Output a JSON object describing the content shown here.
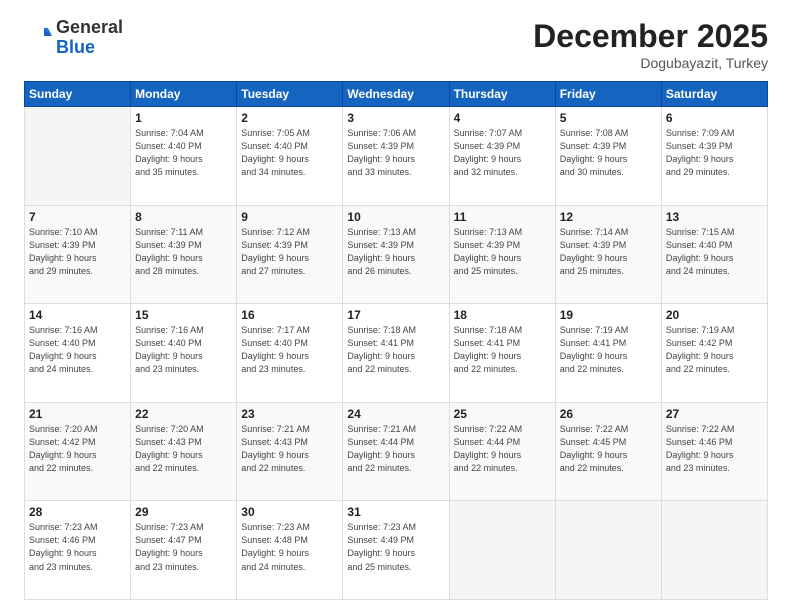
{
  "header": {
    "logo_general": "General",
    "logo_blue": "Blue",
    "month_title": "December 2025",
    "location": "Dogubayazit, Turkey"
  },
  "days_of_week": [
    "Sunday",
    "Monday",
    "Tuesday",
    "Wednesday",
    "Thursday",
    "Friday",
    "Saturday"
  ],
  "weeks": [
    [
      {
        "day": "",
        "info": ""
      },
      {
        "day": "1",
        "info": "Sunrise: 7:04 AM\nSunset: 4:40 PM\nDaylight: 9 hours\nand 35 minutes."
      },
      {
        "day": "2",
        "info": "Sunrise: 7:05 AM\nSunset: 4:40 PM\nDaylight: 9 hours\nand 34 minutes."
      },
      {
        "day": "3",
        "info": "Sunrise: 7:06 AM\nSunset: 4:39 PM\nDaylight: 9 hours\nand 33 minutes."
      },
      {
        "day": "4",
        "info": "Sunrise: 7:07 AM\nSunset: 4:39 PM\nDaylight: 9 hours\nand 32 minutes."
      },
      {
        "day": "5",
        "info": "Sunrise: 7:08 AM\nSunset: 4:39 PM\nDaylight: 9 hours\nand 30 minutes."
      },
      {
        "day": "6",
        "info": "Sunrise: 7:09 AM\nSunset: 4:39 PM\nDaylight: 9 hours\nand 29 minutes."
      }
    ],
    [
      {
        "day": "7",
        "info": "Sunrise: 7:10 AM\nSunset: 4:39 PM\nDaylight: 9 hours\nand 29 minutes."
      },
      {
        "day": "8",
        "info": "Sunrise: 7:11 AM\nSunset: 4:39 PM\nDaylight: 9 hours\nand 28 minutes."
      },
      {
        "day": "9",
        "info": "Sunrise: 7:12 AM\nSunset: 4:39 PM\nDaylight: 9 hours\nand 27 minutes."
      },
      {
        "day": "10",
        "info": "Sunrise: 7:13 AM\nSunset: 4:39 PM\nDaylight: 9 hours\nand 26 minutes."
      },
      {
        "day": "11",
        "info": "Sunrise: 7:13 AM\nSunset: 4:39 PM\nDaylight: 9 hours\nand 25 minutes."
      },
      {
        "day": "12",
        "info": "Sunrise: 7:14 AM\nSunset: 4:39 PM\nDaylight: 9 hours\nand 25 minutes."
      },
      {
        "day": "13",
        "info": "Sunrise: 7:15 AM\nSunset: 4:40 PM\nDaylight: 9 hours\nand 24 minutes."
      }
    ],
    [
      {
        "day": "14",
        "info": "Sunrise: 7:16 AM\nSunset: 4:40 PM\nDaylight: 9 hours\nand 24 minutes."
      },
      {
        "day": "15",
        "info": "Sunrise: 7:16 AM\nSunset: 4:40 PM\nDaylight: 9 hours\nand 23 minutes."
      },
      {
        "day": "16",
        "info": "Sunrise: 7:17 AM\nSunset: 4:40 PM\nDaylight: 9 hours\nand 23 minutes."
      },
      {
        "day": "17",
        "info": "Sunrise: 7:18 AM\nSunset: 4:41 PM\nDaylight: 9 hours\nand 22 minutes."
      },
      {
        "day": "18",
        "info": "Sunrise: 7:18 AM\nSunset: 4:41 PM\nDaylight: 9 hours\nand 22 minutes."
      },
      {
        "day": "19",
        "info": "Sunrise: 7:19 AM\nSunset: 4:41 PM\nDaylight: 9 hours\nand 22 minutes."
      },
      {
        "day": "20",
        "info": "Sunrise: 7:19 AM\nSunset: 4:42 PM\nDaylight: 9 hours\nand 22 minutes."
      }
    ],
    [
      {
        "day": "21",
        "info": "Sunrise: 7:20 AM\nSunset: 4:42 PM\nDaylight: 9 hours\nand 22 minutes."
      },
      {
        "day": "22",
        "info": "Sunrise: 7:20 AM\nSunset: 4:43 PM\nDaylight: 9 hours\nand 22 minutes."
      },
      {
        "day": "23",
        "info": "Sunrise: 7:21 AM\nSunset: 4:43 PM\nDaylight: 9 hours\nand 22 minutes."
      },
      {
        "day": "24",
        "info": "Sunrise: 7:21 AM\nSunset: 4:44 PM\nDaylight: 9 hours\nand 22 minutes."
      },
      {
        "day": "25",
        "info": "Sunrise: 7:22 AM\nSunset: 4:44 PM\nDaylight: 9 hours\nand 22 minutes."
      },
      {
        "day": "26",
        "info": "Sunrise: 7:22 AM\nSunset: 4:45 PM\nDaylight: 9 hours\nand 22 minutes."
      },
      {
        "day": "27",
        "info": "Sunrise: 7:22 AM\nSunset: 4:46 PM\nDaylight: 9 hours\nand 23 minutes."
      }
    ],
    [
      {
        "day": "28",
        "info": "Sunrise: 7:23 AM\nSunset: 4:46 PM\nDaylight: 9 hours\nand 23 minutes."
      },
      {
        "day": "29",
        "info": "Sunrise: 7:23 AM\nSunset: 4:47 PM\nDaylight: 9 hours\nand 23 minutes."
      },
      {
        "day": "30",
        "info": "Sunrise: 7:23 AM\nSunset: 4:48 PM\nDaylight: 9 hours\nand 24 minutes."
      },
      {
        "day": "31",
        "info": "Sunrise: 7:23 AM\nSunset: 4:49 PM\nDaylight: 9 hours\nand 25 minutes."
      },
      {
        "day": "",
        "info": ""
      },
      {
        "day": "",
        "info": ""
      },
      {
        "day": "",
        "info": ""
      }
    ]
  ]
}
